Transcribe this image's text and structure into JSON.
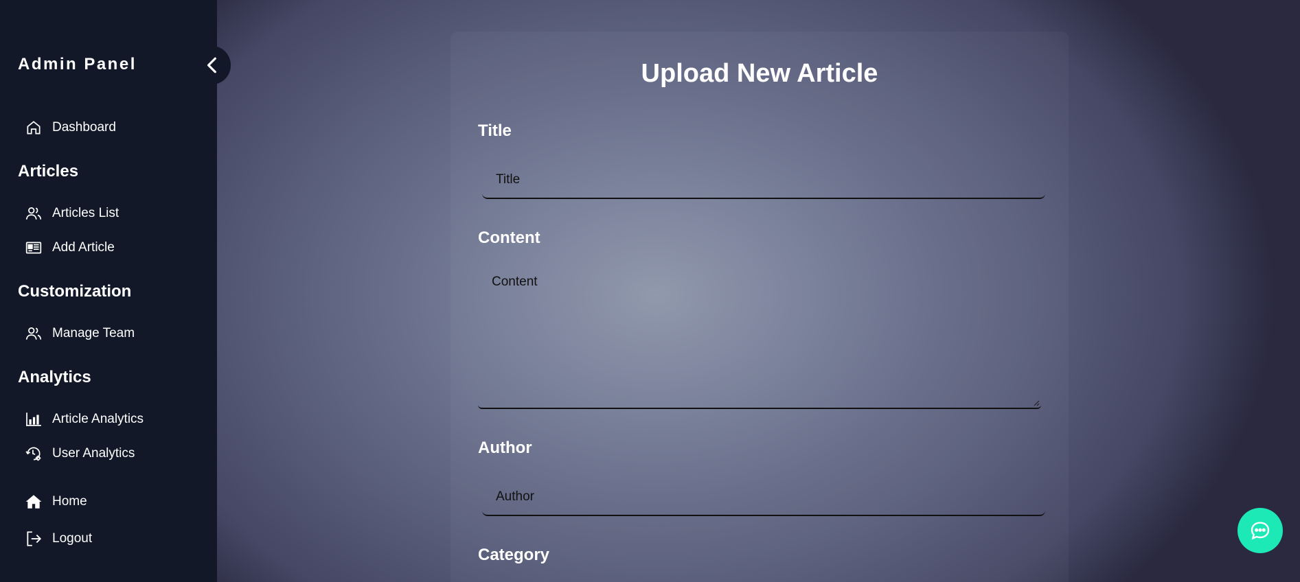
{
  "sidebar": {
    "brand": "Admin Panel",
    "dashboard": "Dashboard",
    "sections": {
      "articles": "Articles",
      "customization": "Customization",
      "analytics": "Analytics"
    },
    "items": {
      "articles_list": "Articles List",
      "add_article": "Add Article",
      "manage_team": "Manage Team",
      "article_analytics": "Article Analytics",
      "user_analytics": "User Analytics",
      "home": "Home",
      "logout": "Logout"
    }
  },
  "form": {
    "title": "Upload New Article",
    "fields": {
      "title_label": "Title",
      "title_placeholder": "Title",
      "content_label": "Content",
      "content_placeholder": "Content",
      "author_label": "Author",
      "author_placeholder": "Author",
      "category_label": "Category"
    }
  },
  "colors": {
    "sidebar_bg": "#121828",
    "accent": "#1de9b6"
  }
}
